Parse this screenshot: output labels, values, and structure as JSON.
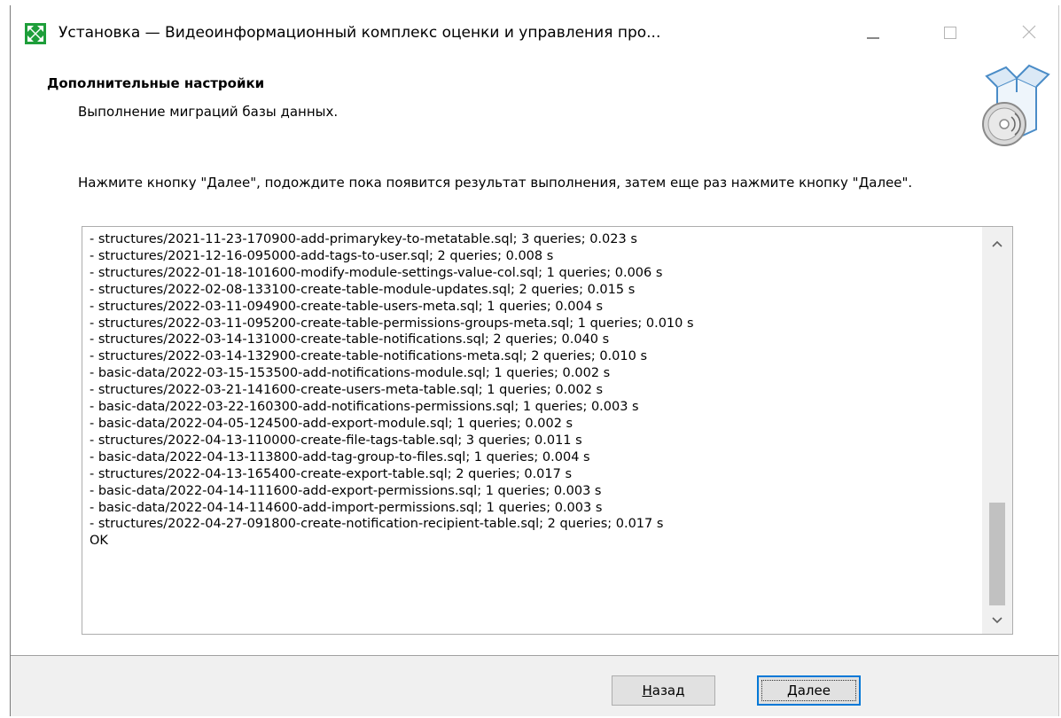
{
  "window": {
    "title": "Установка — Видеоинформационный комплекс оценки и управления про...",
    "app_icon": "installer-logo-icon",
    "controls": {
      "minimize_icon": "minimize-icon",
      "maximize_icon": "maximize-icon",
      "close_icon": "close-icon"
    }
  },
  "header": {
    "title": "Дополнительные настройки",
    "subtitle": "Выполнение миграций базы данных.",
    "graphic": "setup-box-disc-icon"
  },
  "body": {
    "instruction": "Нажмите кнопку \"Далее\", подождите пока появится результат выполнения, затем еще раз нажмите кнопку \"Далее\".",
    "log_lines": [
      "- structures/2021-11-23-170900-add-primarykey-to-metatable.sql; 3 queries; 0.023 s",
      "- structures/2021-12-16-095000-add-tags-to-user.sql; 2 queries; 0.008 s",
      "- structures/2022-01-18-101600-modify-module-settings-value-col.sql; 1 queries; 0.006 s",
      "- structures/2022-02-08-133100-create-table-module-updates.sql; 2 queries; 0.015 s",
      "- structures/2022-03-11-094900-create-table-users-meta.sql; 1 queries; 0.004 s",
      "- structures/2022-03-11-095200-create-table-permissions-groups-meta.sql; 1 queries; 0.010 s",
      "- structures/2022-03-14-131000-create-table-notifications.sql; 2 queries; 0.040 s",
      "- structures/2022-03-14-132900-create-table-notifications-meta.sql; 2 queries; 0.010 s",
      "- basic-data/2022-03-15-153500-add-notifications-module.sql; 1 queries; 0.002 s",
      "- structures/2022-03-21-141600-create-users-meta-table.sql; 1 queries; 0.002 s",
      "- basic-data/2022-03-22-160300-add-notifications-permissions.sql; 1 queries; 0.003 s",
      "- basic-data/2022-04-05-124500-add-export-module.sql; 1 queries; 0.002 s",
      "- structures/2022-04-13-110000-create-file-tags-table.sql; 3 queries; 0.011 s",
      "- basic-data/2022-04-13-113800-add-tag-group-to-files.sql; 1 queries; 0.004 s",
      "- structures/2022-04-13-165400-create-export-table.sql; 2 queries; 0.017 s",
      "- basic-data/2022-04-14-111600-add-export-permissions.sql; 1 queries; 0.003 s",
      "- basic-data/2022-04-14-114600-add-import-permissions.sql; 1 queries; 0.003 s",
      "- structures/2022-04-27-091800-create-notification-recipient-table.sql; 2 queries; 0.017 s",
      "OK"
    ],
    "scrollbar": {
      "up_icon": "chevron-up-icon",
      "down_icon": "chevron-down-icon",
      "position_fraction": 0.88
    }
  },
  "footer": {
    "back_label_accel": "Н",
    "back_label_rest": "азад",
    "next_label_accel": "Д",
    "next_label_rest": "алее"
  },
  "colors": {
    "accent": "#0078d7",
    "logo_green": "#1e9e3a",
    "footer_bg": "#f0f0f0"
  }
}
